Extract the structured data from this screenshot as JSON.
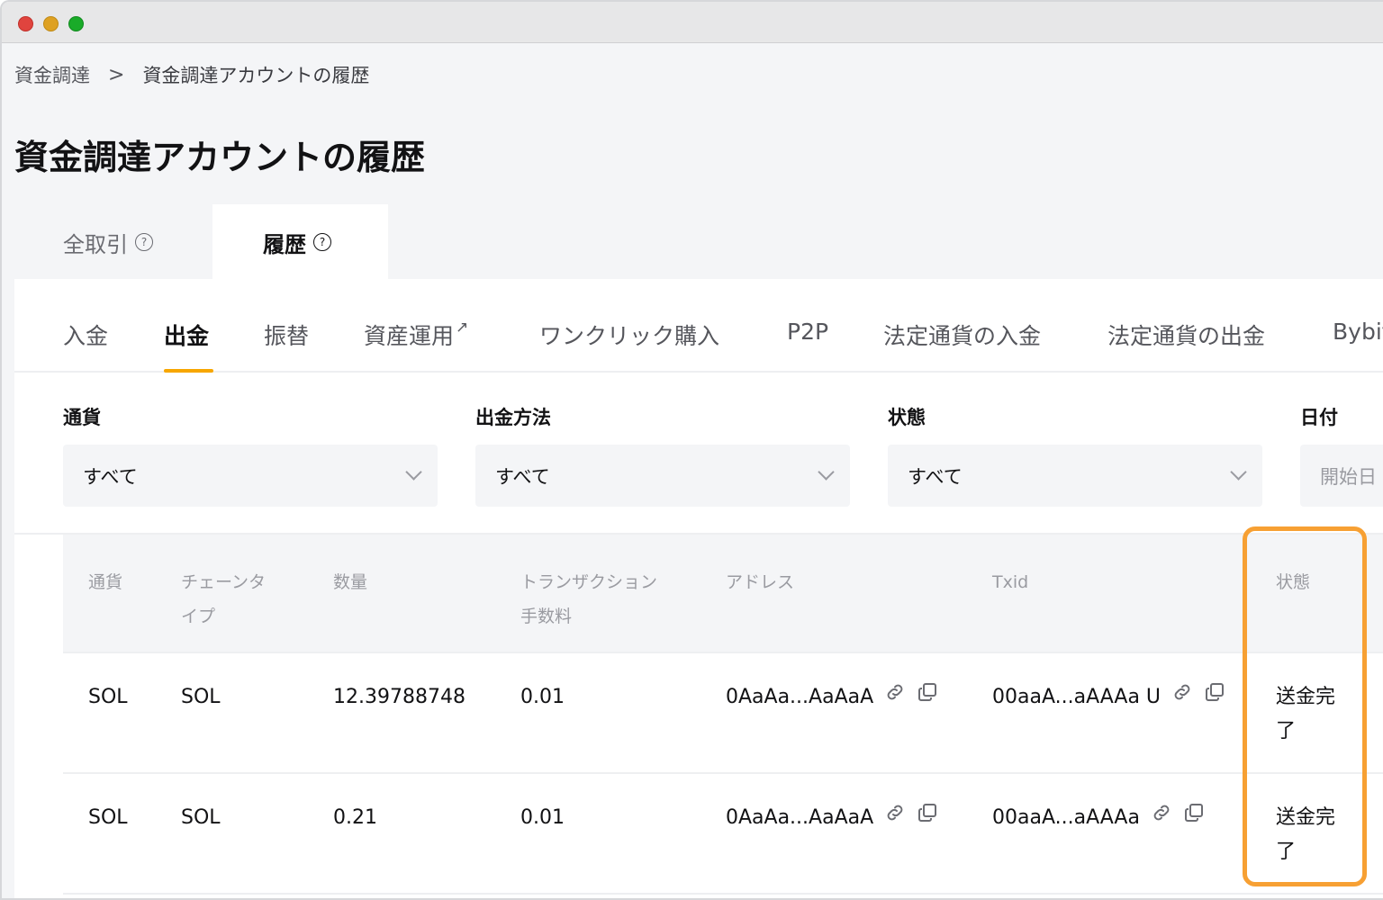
{
  "breadcrumb": {
    "parent": "資金調達",
    "separator": ">",
    "current": "資金調達アカウントの履歴"
  },
  "page": {
    "title": "資金調達アカウントの履歴"
  },
  "main_tabs": [
    {
      "label": "全取引",
      "active": false
    },
    {
      "label": "履歴",
      "active": true
    }
  ],
  "sub_tabs": [
    {
      "label": "入金",
      "active": false
    },
    {
      "label": "出金",
      "active": true
    },
    {
      "label": "振替",
      "active": false
    },
    {
      "label": "資産運用",
      "active": false,
      "external": true
    },
    {
      "label": "ワンクリック購入",
      "active": false
    },
    {
      "label": "P2P",
      "active": false
    },
    {
      "label": "法定通貨の入金",
      "active": false
    },
    {
      "label": "法定通貨の出金",
      "active": false
    },
    {
      "label": "Bybit",
      "active": false
    }
  ],
  "filters": {
    "currency": {
      "label": "通貨",
      "value": "すべて"
    },
    "method": {
      "label": "出金方法",
      "value": "すべて"
    },
    "status": {
      "label": "状態",
      "value": "すべて"
    },
    "date": {
      "label": "日付",
      "placeholder": "開始日"
    }
  },
  "table": {
    "headers": {
      "currency": "通貨",
      "chain_type_1": "チェーンタ",
      "chain_type_2": "イプ",
      "amount": "数量",
      "fee_1": "トランザクション",
      "fee_2": "手数料",
      "address": "アドレス",
      "txid": "Txid",
      "status": "状態"
    },
    "rows": [
      {
        "currency": "SOL",
        "chain": "SOL",
        "amount": "12.39788748",
        "fee": "0.01",
        "address": "0AaAa...AaAaA",
        "txid": "00aaA...aAAAa U",
        "status": "送金完了"
      },
      {
        "currency": "SOL",
        "chain": "SOL",
        "amount": "0.21",
        "fee": "0.01",
        "address": "0AaAa...AaAaA",
        "txid": "00aaA...aAAAa",
        "status": "送金完了"
      }
    ]
  },
  "colors": {
    "accent": "#f7a600",
    "highlight": "#f7a033"
  }
}
